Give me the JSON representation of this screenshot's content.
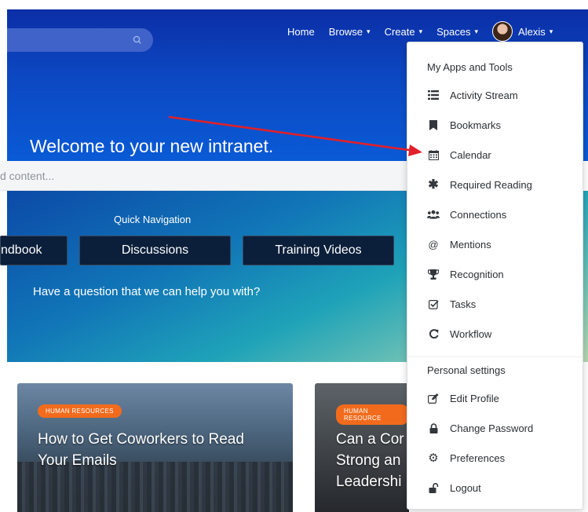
{
  "header": {
    "nav": [
      {
        "label": "Home",
        "caret": ""
      },
      {
        "label": "Browse",
        "caret": "▾"
      },
      {
        "label": "Create",
        "caret": "▾"
      },
      {
        "label": "Spaces",
        "caret": "▾"
      }
    ],
    "user": {
      "name": "Alexis",
      "caret": "▾"
    }
  },
  "hero": {
    "title": "Welcome to your new intranet."
  },
  "search": {
    "placeholder_fragment": "d content..."
  },
  "quick_nav": {
    "label": "Quick Navigation",
    "buttons": [
      "ndbook",
      "Discussions",
      "Training Videos"
    ],
    "question": "Have a question that we can help you with?"
  },
  "cards": [
    {
      "badge": "HUMAN RESOURCES",
      "title_lines": [
        "How to Get Coworkers to Read",
        "Your Emails"
      ]
    },
    {
      "badge": "HUMAN RESOURCE",
      "title_lines": [
        "Can a Cor",
        "Strong an",
        "Leadershi"
      ]
    }
  ],
  "menu": {
    "section1": "My Apps and Tools",
    "apps": [
      {
        "label": "Activity Stream",
        "icon": "list-icon"
      },
      {
        "label": "Bookmarks",
        "icon": "bookmark-icon"
      },
      {
        "label": "Calendar",
        "icon": "calendar-icon"
      },
      {
        "label": "Required Reading",
        "icon": "asterisk-icon"
      },
      {
        "label": "Connections",
        "icon": "users-icon"
      },
      {
        "label": "Mentions",
        "icon": "at-icon"
      },
      {
        "label": "Recognition",
        "icon": "trophy-icon"
      },
      {
        "label": "Tasks",
        "icon": "checkbox-icon"
      },
      {
        "label": "Workflow",
        "icon": "refresh-icon"
      }
    ],
    "section2": "Personal settings",
    "settings": [
      {
        "label": "Edit Profile",
        "icon": "edit-icon"
      },
      {
        "label": "Change Password",
        "icon": "lock-icon"
      },
      {
        "label": "Preferences",
        "icon": "gear-icon"
      },
      {
        "label": "Logout",
        "icon": "unlock-icon"
      }
    ]
  },
  "colors": {
    "hero": "#0c48c2",
    "badge": "#f26b1d",
    "arrow": "#e0202a"
  }
}
